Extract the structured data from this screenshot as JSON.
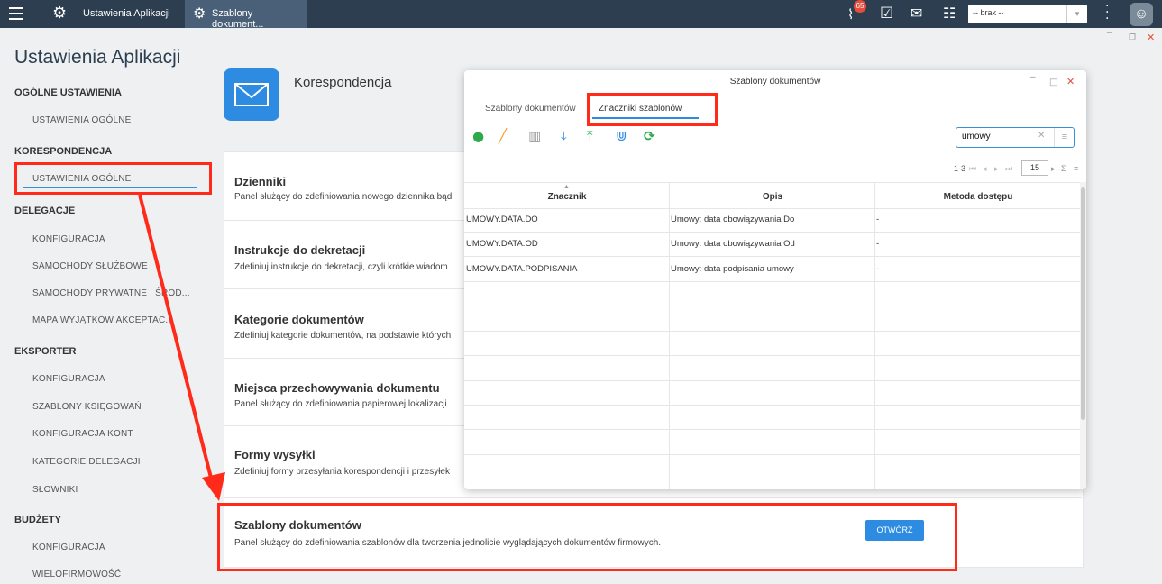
{
  "topbar": {
    "app_tab": "Ustawienia Aplikacji",
    "doc_tab": "Szablony dokument...",
    "notification_count": "65",
    "company_select": "-- brak --",
    "icons": [
      "menu-icon",
      "gears-icon",
      "settings-icon",
      "rss-icon",
      "calendar-check-icon",
      "chat-icon",
      "sitemap-icon",
      "dots-vertical-icon",
      "user-icon"
    ]
  },
  "sidebar": {
    "title": "Ustawienia Aplikacji",
    "sections": [
      {
        "label": "OGÓLNE USTAWIENIA",
        "items": [
          "USTAWIENIA OGÓLNE"
        ]
      },
      {
        "label": "KORESPONDENCJA",
        "items": [
          "USTAWIENIA OGÓLNE"
        ]
      },
      {
        "label": "DELEGACJE",
        "items": [
          "KONFIGURACJA",
          "SAMOCHODY SŁUŻBOWE",
          "SAMOCHODY PRYWATNE I ŚROD...",
          "MAPA WYJĄTKÓW AKCEPTAC..."
        ]
      },
      {
        "label": "EKSPORTER",
        "items": [
          "KONFIGURACJA",
          "SZABLONY KSIĘGOWAŃ",
          "KONFIGURACJA KONT",
          "KATEGORIE DELEGACJI",
          "SŁOWNIKI"
        ]
      },
      {
        "label": "BUDŻETY",
        "items": [
          "KONFIGURACJA",
          "WIELOFIRMOWOŚĆ"
        ]
      }
    ]
  },
  "main": {
    "section_title": "Korespondencja",
    "items": [
      {
        "title": "Dzienniki",
        "desc": "Panel służący do zdefiniowania nowego dziennika bąd"
      },
      {
        "title": "Instrukcje do dekretacji",
        "desc": "Zdefiniuj instrukcje do dekretacji, czyli krótkie wiadom"
      },
      {
        "title": "Kategorie dokumentów",
        "desc": "Zdefiniuj kategorie dokumentów, na podstawie których"
      },
      {
        "title": "Miejsca przechowywania dokumentu",
        "desc": "Panel służący do zdefiniowania papierowej lokalizacji"
      },
      {
        "title": "Formy wysyłki",
        "desc": "Zdefiniuj formy przesyłania korespondencji i przesyłek"
      },
      {
        "title": "Szablony dokumentów",
        "desc": "Panel służący do zdefiniowania szablonów dla tworzenia jednolicie wyglądających dokumentów firmowych."
      }
    ],
    "open_button": "OTWÓRZ"
  },
  "modal": {
    "title": "Szablony dokumentów",
    "tabs": [
      "Szablony dokumentów",
      "Znaczniki szablonów"
    ],
    "active_tab": 1,
    "search_value": "umowy",
    "pager": {
      "range": "1-3",
      "page_size": "15"
    },
    "columns": [
      "Znacznik",
      "Opis",
      "Metoda dostępu"
    ],
    "rows": [
      [
        "UMOWY.DATA.DO",
        "Umowy: data obowiązywania Do",
        "-"
      ],
      [
        "UMOWY.DATA.OD",
        "Umowy: data obowiązywania Od",
        "-"
      ],
      [
        "UMOWY.DATA.PODPISANIA",
        "Umowy: data podpisania umowy",
        "-"
      ]
    ],
    "toolbar_icons": [
      "add-icon",
      "edit-icon",
      "delete-icon",
      "download-icon",
      "upload-icon",
      "merge-icon",
      "refresh-icon"
    ]
  },
  "colors": {
    "topbar": "#2c3e50",
    "accent": "#2d8ce2",
    "annotation": "#ff2a1a"
  }
}
